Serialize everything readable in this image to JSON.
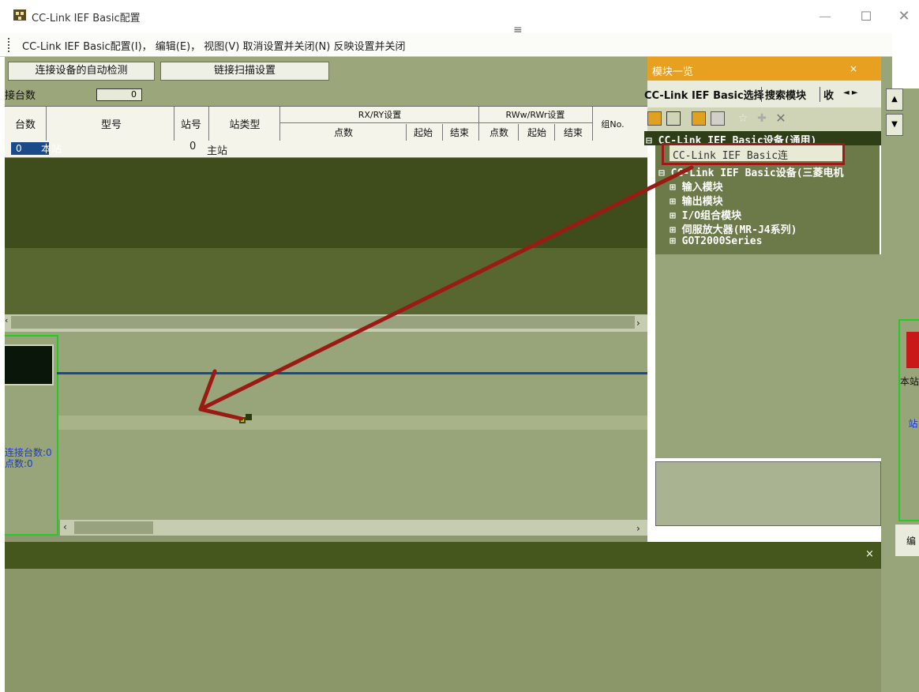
{
  "window": {
    "title": "CC-Link IEF Basic配置",
    "min": "—",
    "max": "☐",
    "close": "✕"
  },
  "menu": {
    "text": "CC-Link IEF Basic配置(I)， 编辑(E)， 视图(V)  取消设置并关闭(N)  反映设置并关闭",
    "hamburger": "≡"
  },
  "toolbar": {
    "autodetect_label": "连接设备的自动检测",
    "linkscan_label": "链接扫描设置"
  },
  "count": {
    "label": "接台数",
    "value": "0"
  },
  "table": {
    "headers": {
      "count": "台数",
      "model": "型号",
      "station_no": "站号",
      "station_type": "站类型",
      "rxry": "RX/RY设置",
      "rwwrwr": "RWw/RWr设置",
      "group": "组No.",
      "points": "点数",
      "start": "起始",
      "end": "结束",
      "points2": "点数",
      "start2": "起始",
      "end2": "结束"
    },
    "row1": {
      "count": "0",
      "type": "本站",
      "station_no": "0",
      "station_type": "主站"
    }
  },
  "diagram": {
    "info1": "连接台数:0",
    "info2": "点数:0"
  },
  "module_panel": {
    "title": "模块一览",
    "close": "×",
    "tabs": [
      "CC-Link IEF Basic选择",
      "搜索模块",
      "收"
    ],
    "tab_arrows": "◄ ►",
    "tree": {
      "group1": "⊟ CC-Link IEF Basic设备(通用)",
      "selected": "CC-Link IEF Basic连",
      "group2": "⊟ CC-Link IEF Basic设备(三菱电机",
      "items": [
        "⊞ 输入模块",
        "⊞ 输出模块",
        "⊞ I/O组合模块",
        "⊞ 伺服放大器(MR-J4系列)",
        "⊞ GOT2000Series"
      ]
    }
  },
  "right_strip": {
    "label": "本站",
    "vlabel": "站",
    "lower_tab": "编",
    "up": "▲",
    "down": "▼"
  },
  "bottom": {
    "close": "×"
  },
  "scroll": {
    "left": "‹",
    "right": "›"
  },
  "colors": {
    "accent_title": "#e8a020",
    "highlight_red": "#a01818",
    "arrow": "#9a1a14",
    "station_green": "#22cc22",
    "bus": "#1a4a8a"
  }
}
